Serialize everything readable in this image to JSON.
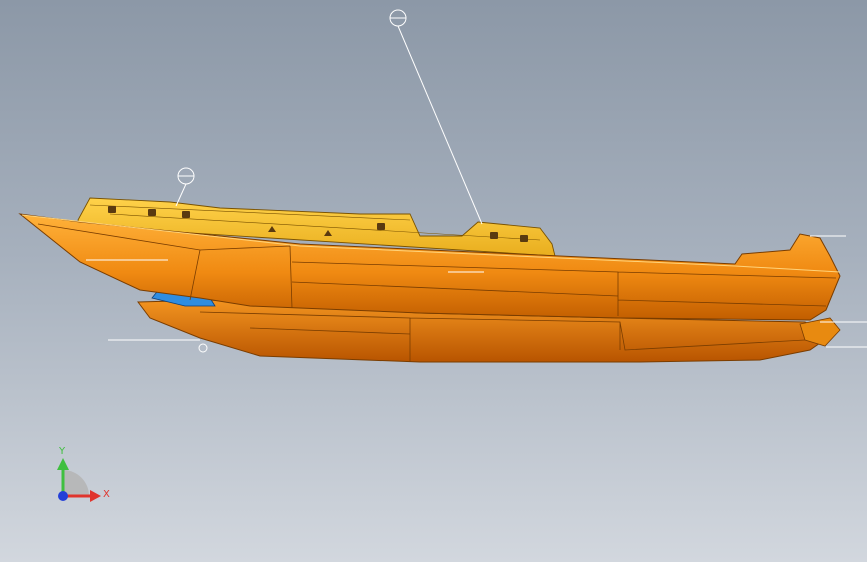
{
  "viewport": {
    "background_top": "#8c98a7",
    "background_bottom": "#d2d7de"
  },
  "model": {
    "hull_color": "#f59a1c",
    "deck_color": "#f5c63a",
    "hull_edge_color": "#7a3d00",
    "blue_part_color": "#2f8de0"
  },
  "triad": {
    "y_label": "Y",
    "x_label": "X",
    "y_color": "#3fbf3f",
    "x_color": "#e0342c",
    "z_color": "#2440d8"
  },
  "icons": {
    "annotation_marker": "annotation-circle-icon",
    "triad": "coordinate-triad-icon"
  }
}
